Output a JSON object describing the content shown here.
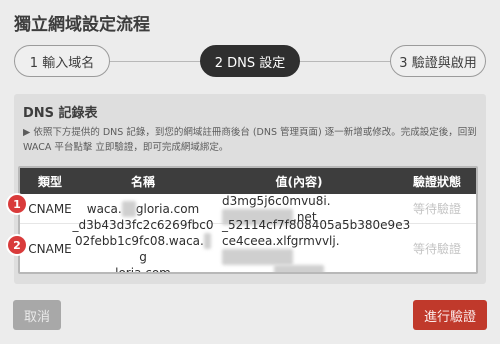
{
  "modal": {
    "title": "獨立網域設定流程"
  },
  "steps": [
    {
      "label": "1 輸入域名"
    },
    {
      "label": "2 DNS 設定"
    },
    {
      "label": "3 驗證與啟用"
    }
  ],
  "panel": {
    "title": "DNS 記錄表",
    "notice": "▶ 依照下方提供的 DNS 記錄，到您的網域註冊商後台 (DNS 管理頁面) 逐一新增或修改。完成設定後，回到 WACA 平台點擊 立即驗證，即可完成網域綁定。"
  },
  "table": {
    "headers": [
      "類型",
      "名稱",
      "值(內容)",
      "驗證狀態"
    ],
    "rows": [
      {
        "badge": "1",
        "type": "CNAME",
        "name_a": "waca.",
        "name_blur": "xx",
        "name_b": "gloria.com",
        "value_a": "d3mg5j6c0mvu8i.",
        "value_blur": "xxxxxxxxxx",
        "value_b": ".net",
        "status": "等待驗證"
      },
      {
        "badge": "2",
        "type": "CNAME",
        "name_l1": "_d3b43d3fc2c6269fbc0",
        "name_l2a": "02febb1c9fc08.waca.",
        "name_l2blur": "x",
        "name_l2b": "g",
        "name_l3": "loria.com",
        "value_l1": "_52114cf7f808405a5b380e9e3",
        "value_l2a": "ce4ceea.xlfgrmvvlj.",
        "value_l2blur": "xxxxxxxxxx",
        "value_l3blur": "xxxxxxx",
        "status": "等待驗證"
      }
    ]
  },
  "buttons": {
    "cancel": "取消",
    "verify": "進行驗證"
  }
}
